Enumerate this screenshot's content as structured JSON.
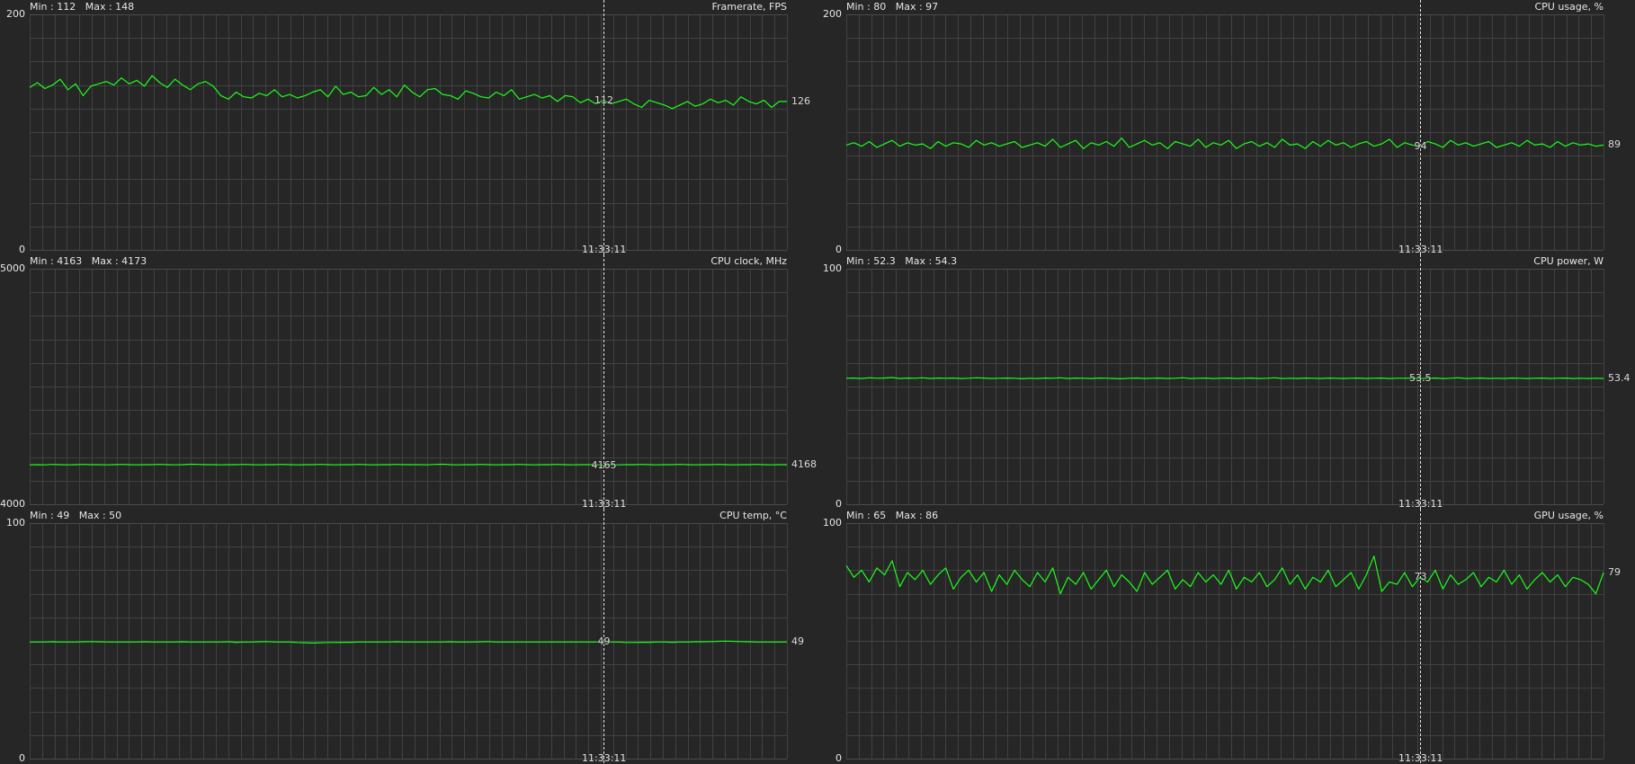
{
  "colors": {
    "background": "#262626",
    "plot_area": "#262626",
    "grid": "#414141",
    "grid_major": "#4b4b4b",
    "line": "#19ff19",
    "cursor": "#e6e6e6",
    "text": "#e6e6e6"
  },
  "cursor_time": "11:33:11",
  "chart_data": [
    {
      "type": "line",
      "title": "Framerate, FPS",
      "stats": {
        "min_label": "Min : 112",
        "max_label": "Max : 148"
      },
      "ylim": [
        0,
        200
      ],
      "ylabels": {
        "top": "200",
        "bottom": "0"
      },
      "cursor_value": "112",
      "current_value": "126",
      "series": [
        {
          "values": [
            138,
            142,
            137,
            140,
            145,
            136,
            141,
            131,
            139,
            141,
            143,
            140,
            146,
            141,
            144,
            139,
            148,
            142,
            138,
            145,
            140,
            136,
            141,
            143,
            139,
            131,
            128,
            134,
            130,
            129,
            133,
            131,
            136,
            130,
            132,
            129,
            131,
            134,
            136,
            130,
            139,
            132,
            134,
            130,
            131,
            138,
            132,
            136,
            130,
            140,
            134,
            130,
            136,
            137,
            132,
            131,
            128,
            135,
            133,
            130,
            129,
            134,
            131,
            136,
            128,
            130,
            132,
            129,
            131,
            126,
            131,
            130,
            125,
            128,
            124,
            127,
            124,
            126,
            128,
            124,
            121,
            127,
            125,
            123,
            120,
            123,
            126,
            122,
            124,
            128,
            125,
            127,
            123,
            130,
            126,
            124,
            127,
            121,
            126,
            126
          ]
        }
      ]
    },
    {
      "type": "line",
      "title": "CPU usage, %",
      "stats": {
        "min_label": "Min : 80",
        "max_label": "Max : 97"
      },
      "ylim": [
        0,
        200
      ],
      "ylabels": {
        "top": "200",
        "bottom": "0"
      },
      "cursor_value": "94",
      "current_value": "89",
      "series": [
        {
          "values": [
            89,
            91,
            88,
            92,
            87,
            90,
            93,
            88,
            91,
            89,
            90,
            86,
            92,
            88,
            91,
            90,
            87,
            93,
            89,
            91,
            88,
            90,
            92,
            87,
            89,
            91,
            88,
            94,
            87,
            90,
            93,
            86,
            91,
            89,
            92,
            88,
            95,
            87,
            90,
            93,
            89,
            91,
            86,
            92,
            90,
            88,
            94,
            87,
            91,
            89,
            93,
            86,
            90,
            92,
            88,
            91,
            87,
            94,
            89,
            90,
            86,
            92,
            88,
            93,
            89,
            91,
            87,
            90,
            92,
            88,
            90,
            94,
            87,
            91,
            89,
            88,
            92,
            90,
            87,
            93,
            89,
            91,
            88,
            90,
            92,
            87,
            89,
            91,
            88,
            93,
            89,
            90,
            87,
            92,
            88,
            91,
            89,
            90,
            88,
            89
          ]
        }
      ]
    },
    {
      "type": "line",
      "title": "CPU clock, MHz",
      "stats": {
        "min_label": "Min : 4163",
        "max_label": "Max : 4173"
      },
      "ylim": [
        4000,
        5000
      ],
      "ylabels": {
        "top": "5000",
        "bottom": "4000"
      },
      "cursor_value": "4165",
      "current_value": "4168",
      "series": [
        {
          "values": [
            4167,
            4168,
            4167,
            4169,
            4168,
            4167,
            4168,
            4169,
            4168,
            4168,
            4167,
            4168,
            4169,
            4168,
            4167,
            4168,
            4168,
            4169,
            4168,
            4167,
            4168,
            4170,
            4169,
            4168,
            4168,
            4167,
            4168,
            4168,
            4169,
            4168,
            4167,
            4168,
            4168,
            4169,
            4168,
            4167,
            4168,
            4168,
            4169,
            4168,
            4167,
            4168,
            4168,
            4169,
            4168,
            4167,
            4168,
            4168,
            4169,
            4168,
            4168,
            4168,
            4167,
            4169,
            4170,
            4168,
            4167,
            4168,
            4168,
            4169,
            4168,
            4167,
            4168,
            4168,
            4169,
            4168,
            4167,
            4168,
            4168,
            4169,
            4168,
            4167,
            4168,
            4168,
            4169,
            4165,
            4168,
            4167,
            4168,
            4168,
            4169,
            4168,
            4167,
            4168,
            4168,
            4169,
            4168,
            4167,
            4168,
            4168,
            4169,
            4168,
            4167,
            4168,
            4168,
            4169,
            4168,
            4167,
            4168,
            4168
          ]
        }
      ]
    },
    {
      "type": "line",
      "title": "CPU power, W",
      "stats": {
        "min_label": "Min : 52.3",
        "max_label": "Max : 54.3"
      },
      "ylim": [
        0,
        100
      ],
      "ylabels": {
        "top": "100",
        "bottom": "0"
      },
      "cursor_value": "53.5",
      "current_value": "53.4",
      "series": [
        {
          "values": [
            53.5,
            53.6,
            53.4,
            53.7,
            53.5,
            53.6,
            53.8,
            53.4,
            53.6,
            53.5,
            53.7,
            53.4,
            53.6,
            53.5,
            53.6,
            53.4,
            53.5,
            53.7,
            53.6,
            53.4,
            53.5,
            53.6,
            53.5,
            53.3,
            53.5,
            53.4,
            53.6,
            53.5,
            53.7,
            53.4,
            53.6,
            53.5,
            53.4,
            53.6,
            53.5,
            53.4,
            53.3,
            53.5,
            53.6,
            53.4,
            53.5,
            53.6,
            53.4,
            53.5,
            53.7,
            53.4,
            53.5,
            53.6,
            53.4,
            53.5,
            53.6,
            53.4,
            53.5,
            53.6,
            53.4,
            53.5,
            53.7,
            53.4,
            53.5,
            53.4,
            53.6,
            53.5,
            53.4,
            53.6,
            53.5,
            53.4,
            53.5,
            53.6,
            53.4,
            53.5,
            53.6,
            53.4,
            53.5,
            53.5,
            53.6,
            53.4,
            53.5,
            53.6,
            53.4,
            53.5,
            53.7,
            53.4,
            53.5,
            53.6,
            53.4,
            53.5,
            53.4,
            53.6,
            53.5,
            53.4,
            53.5,
            53.6,
            53.4,
            53.5,
            53.6,
            53.4,
            53.5,
            53.4,
            53.5,
            53.4
          ]
        }
      ]
    },
    {
      "type": "line",
      "title": "CPU temp, °C",
      "stats": {
        "min_label": "Min : 49",
        "max_label": "Max : 50"
      },
      "ylim": [
        0,
        100
      ],
      "ylabels": {
        "top": "100",
        "bottom": "0"
      },
      "cursor_value": "49",
      "current_value": "49",
      "series": [
        {
          "values": [
            49.5,
            49.5,
            49.5,
            49.6,
            49.5,
            49.5,
            49.5,
            49.6,
            49.7,
            49.6,
            49.5,
            49.5,
            49.5,
            49.5,
            49.5,
            49.6,
            49.5,
            49.5,
            49.5,
            49.5,
            49.6,
            49.5,
            49.5,
            49.5,
            49.5,
            49.5,
            49.6,
            49.4,
            49.5,
            49.5,
            49.6,
            49.7,
            49.5,
            49.5,
            49.5,
            49.3,
            49.2,
            49.1,
            49.2,
            49.3,
            49.3,
            49.4,
            49.4,
            49.5,
            49.5,
            49.5,
            49.5,
            49.5,
            49.6,
            49.5,
            49.5,
            49.5,
            49.5,
            49.5,
            49.5,
            49.6,
            49.5,
            49.5,
            49.5,
            49.6,
            49.7,
            49.5,
            49.5,
            49.5,
            49.5,
            49.5,
            49.5,
            49.5,
            49.5,
            49.5,
            49.5,
            49.5,
            49.5,
            49.5,
            49.5,
            49.5,
            49.5,
            49.5,
            49.3,
            49.3,
            49.4,
            49.4,
            49.5,
            49.5,
            49.4,
            49.5,
            49.5,
            49.6,
            49.6,
            49.7,
            49.8,
            49.9,
            49.8,
            49.7,
            49.6,
            49.5,
            49.5,
            49.5,
            49.5,
            49.5
          ]
        }
      ]
    },
    {
      "type": "line",
      "title": "GPU usage, %",
      "stats": {
        "min_label": "Min : 65",
        "max_label": "Max : 86"
      },
      "ylim": [
        0,
        100
      ],
      "ylabels": {
        "top": "100",
        "bottom": "0"
      },
      "cursor_value": "73",
      "current_value": "79",
      "series": [
        {
          "values": [
            82,
            77,
            80,
            75,
            81,
            78,
            84,
            73,
            79,
            76,
            80,
            74,
            78,
            81,
            72,
            77,
            80,
            75,
            79,
            71,
            78,
            74,
            80,
            76,
            73,
            79,
            75,
            81,
            70,
            77,
            74,
            79,
            72,
            76,
            80,
            73,
            78,
            75,
            71,
            79,
            74,
            77,
            80,
            72,
            76,
            73,
            79,
            75,
            78,
            74,
            80,
            72,
            77,
            75,
            79,
            73,
            76,
            81,
            74,
            78,
            72,
            77,
            75,
            80,
            73,
            76,
            79,
            72,
            78,
            86,
            71,
            75,
            74,
            79,
            73,
            77,
            75,
            80,
            72,
            78,
            74,
            76,
            79,
            73,
            77,
            75,
            80,
            74,
            78,
            72,
            76,
            79,
            75,
            78,
            73,
            77,
            76,
            74,
            70,
            79
          ]
        }
      ]
    }
  ]
}
